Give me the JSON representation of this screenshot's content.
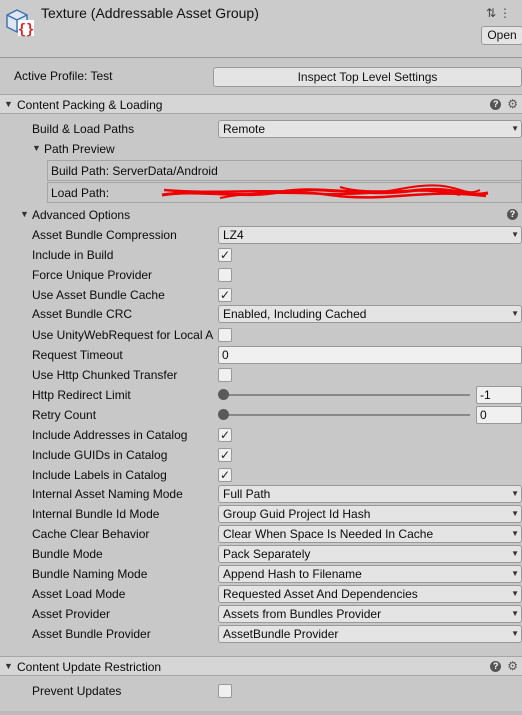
{
  "header": {
    "title": "Texture (Addressable Asset Group)",
    "open_label": "Open",
    "icons": [
      "addressable-group-icon",
      "adjust-icon",
      "more-icon"
    ]
  },
  "profile": {
    "label": "Active Profile: Test",
    "inspect_label": "Inspect Top Level Settings"
  },
  "content_packing": {
    "title": "Content Packing & Loading",
    "build_load_paths": {
      "label": "Build & Load Paths",
      "value": "Remote"
    },
    "path_preview": {
      "title": "Path Preview",
      "build_path": "Build Path: ServerData/Android",
      "load_path": "Load Path: "
    },
    "advanced": {
      "title": "Advanced Options",
      "compression": {
        "label": "Asset Bundle Compression",
        "value": "LZ4"
      },
      "include_in_build": {
        "label": "Include in Build",
        "checked": true
      },
      "force_unique_provider": {
        "label": "Force Unique Provider",
        "checked": false
      },
      "use_bundle_cache": {
        "label": "Use Asset Bundle Cache",
        "checked": true
      },
      "bundle_crc": {
        "label": "Asset Bundle CRC",
        "value": "Enabled, Including Cached"
      },
      "use_uwr_local": {
        "label": "Use UnityWebRequest for Local A",
        "checked": false
      },
      "request_timeout": {
        "label": "Request Timeout",
        "value": "0"
      },
      "http_chunked": {
        "label": "Use Http Chunked Transfer",
        "checked": false
      },
      "http_redirect": {
        "label": "Http Redirect Limit",
        "value": "-1"
      },
      "retry_count": {
        "label": "Retry Count",
        "value": "0"
      },
      "include_addresses": {
        "label": "Include Addresses in Catalog",
        "checked": true
      },
      "include_guids": {
        "label": "Include GUIDs in Catalog",
        "checked": true
      },
      "include_labels": {
        "label": "Include Labels in Catalog",
        "checked": true
      },
      "internal_naming": {
        "label": "Internal Asset Naming Mode",
        "value": "Full Path"
      },
      "internal_bundle_id": {
        "label": "Internal Bundle Id Mode",
        "value": "Group Guid Project Id Hash"
      },
      "cache_clear": {
        "label": "Cache Clear Behavior",
        "value": "Clear When Space Is Needed In Cache"
      },
      "bundle_mode": {
        "label": "Bundle Mode",
        "value": "Pack Separately"
      },
      "bundle_naming": {
        "label": "Bundle Naming Mode",
        "value": "Append Hash to Filename"
      },
      "asset_load_mode": {
        "label": "Asset Load Mode",
        "value": "Requested Asset And Dependencies"
      },
      "asset_provider": {
        "label": "Asset Provider",
        "value": "Assets from Bundles Provider"
      },
      "bundle_provider": {
        "label": "Asset Bundle Provider",
        "value": "AssetBundle Provider"
      }
    }
  },
  "content_update": {
    "title": "Content Update Restriction",
    "prevent_updates": {
      "label": "Prevent Updates",
      "checked": false
    }
  },
  "glyphs": {
    "check": "✓",
    "caret": "▼",
    "expanded": "▼",
    "help": "?",
    "gear": "⚙"
  }
}
